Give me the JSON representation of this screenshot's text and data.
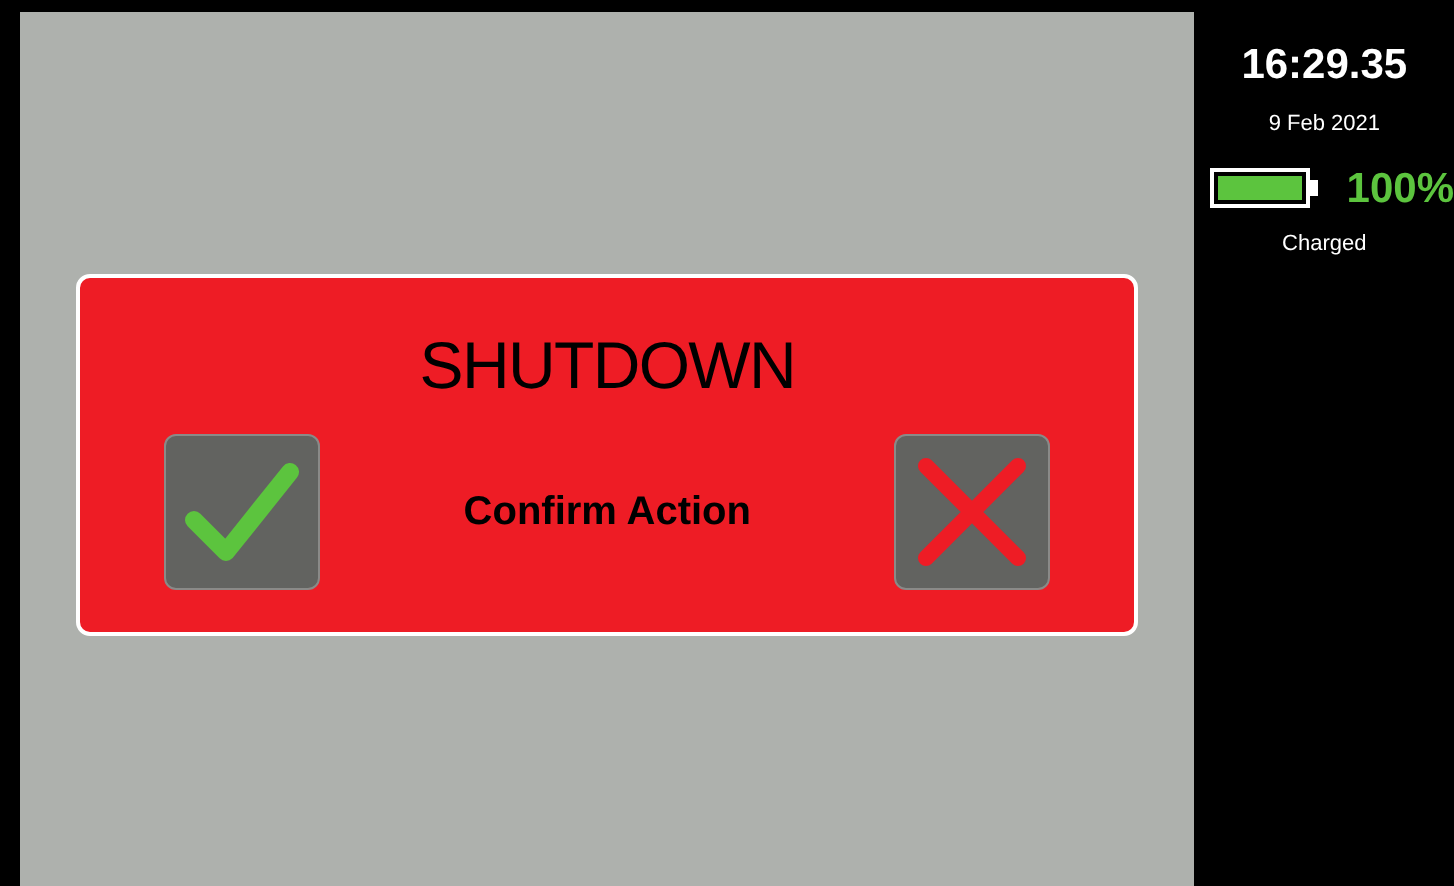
{
  "dialog": {
    "title": "SHUTDOWN",
    "message": "Confirm Action"
  },
  "status": {
    "time": "16:29.35",
    "date": "9 Feb 2021",
    "battery_percent": "100%",
    "battery_state": "Charged"
  }
}
